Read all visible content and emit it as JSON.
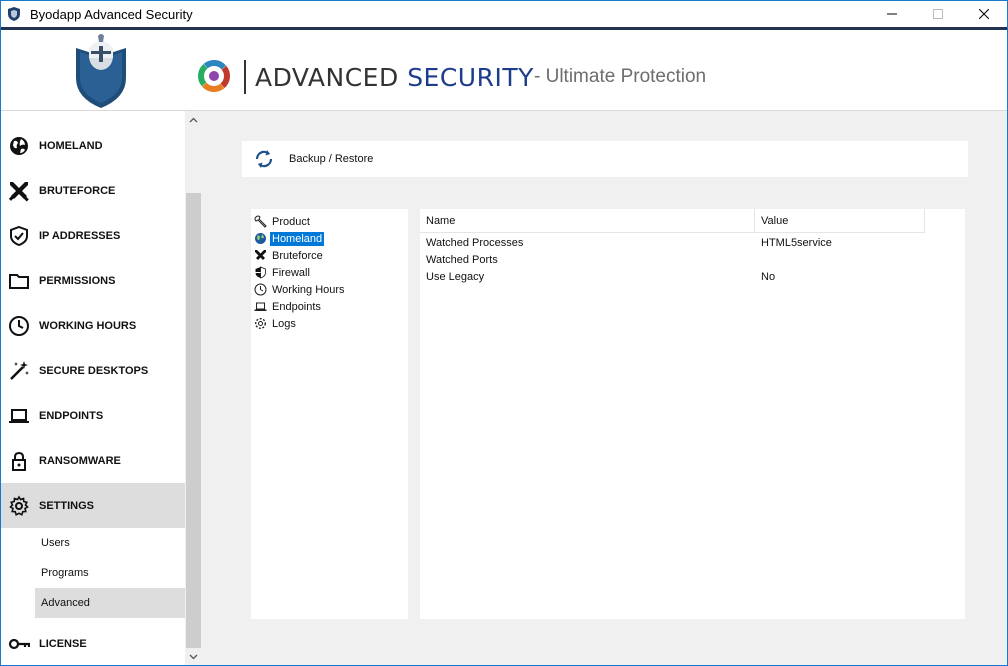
{
  "window": {
    "title": "Byodapp Advanced Security"
  },
  "header": {
    "brand_word1": "ADVANCED",
    "brand_word2": "SECURITY",
    "tagline": "- Ultimate Protection"
  },
  "sidebar": {
    "items": [
      {
        "label": "HOMELAND",
        "icon": "globe-icon"
      },
      {
        "label": "BRUTEFORCE",
        "icon": "crossed-swords-icon"
      },
      {
        "label": "IP ADDRESSES",
        "icon": "shield-check-icon"
      },
      {
        "label": "PERMISSIONS",
        "icon": "folder-icon"
      },
      {
        "label": "WORKING HOURS",
        "icon": "clock-icon"
      },
      {
        "label": "SECURE DESKTOPS",
        "icon": "magic-wand-icon"
      },
      {
        "label": "ENDPOINTS",
        "icon": "laptop-icon"
      },
      {
        "label": "RANSOMWARE",
        "icon": "lock-icon"
      },
      {
        "label": "SETTINGS",
        "icon": "gear-icon"
      }
    ],
    "sub_items": [
      {
        "label": "Users"
      },
      {
        "label": "Programs"
      },
      {
        "label": "Advanced"
      }
    ],
    "license_label": "LICENSE"
  },
  "toolbar": {
    "backup_label": "Backup / Restore"
  },
  "tree": {
    "nodes": [
      {
        "label": "Product",
        "icon": "wrench-icon"
      },
      {
        "label": "Homeland",
        "icon": "globe-icon"
      },
      {
        "label": "Bruteforce",
        "icon": "crossed-swords-icon"
      },
      {
        "label": "Firewall",
        "icon": "shield-icon"
      },
      {
        "label": "Working Hours",
        "icon": "clock-icon"
      },
      {
        "label": "Endpoints",
        "icon": "laptop-icon"
      },
      {
        "label": "Logs",
        "icon": "gear-icon"
      }
    ],
    "selected": "Homeland"
  },
  "grid": {
    "columns": [
      "Name",
      "Value"
    ],
    "rows": [
      {
        "name": "Watched Processes",
        "value": "HTML5service"
      },
      {
        "name": "Watched Ports",
        "value": ""
      },
      {
        "name": "Use Legacy",
        "value": "No"
      }
    ]
  },
  "colors": {
    "accent": "#0078d7",
    "header_border": "#22344f",
    "brand_blue": "#1e3c8c",
    "active_bg": "#dddddd"
  }
}
